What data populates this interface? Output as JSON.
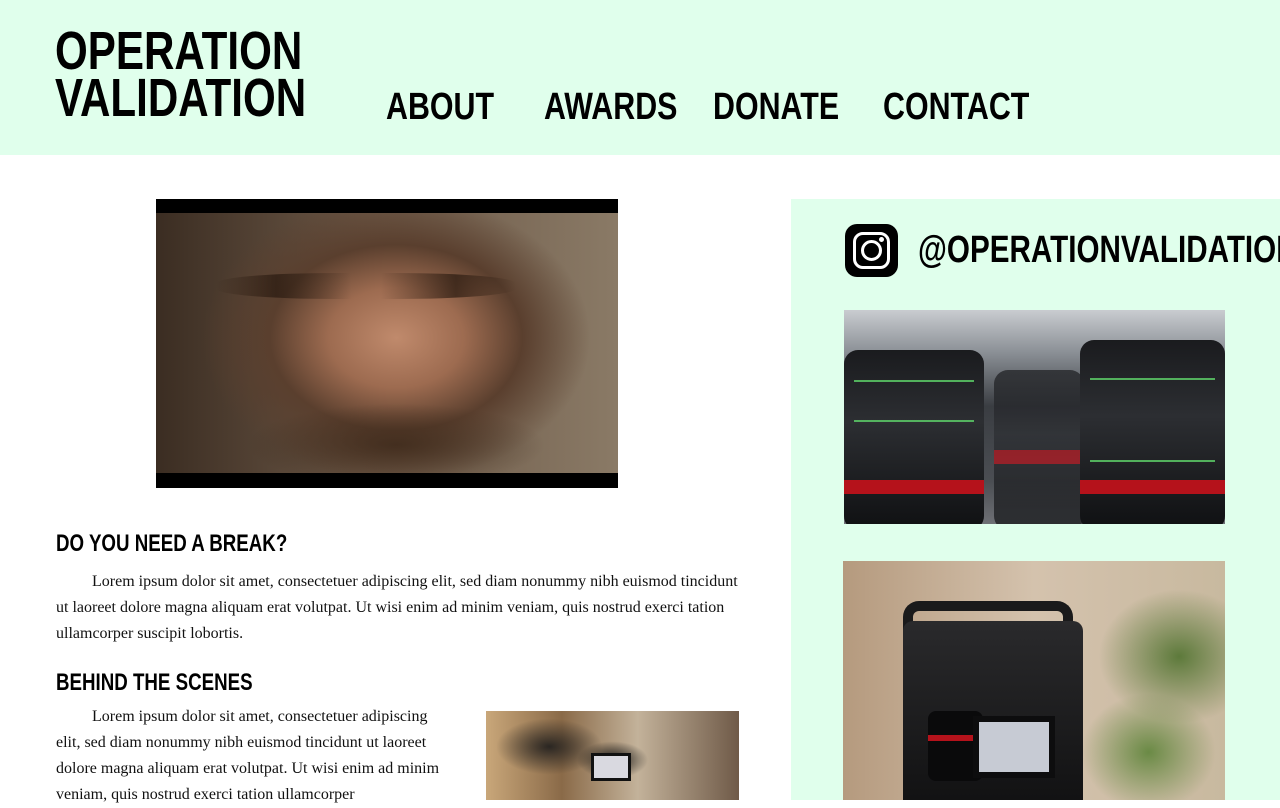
{
  "header": {
    "logo_line1": "OPERATION",
    "logo_line2": "VALIDATION",
    "nav": [
      "ABOUT",
      "AWARDS",
      "DONATE",
      "CONTACT"
    ]
  },
  "main": {
    "section1_heading": "DO YOU NEED A BREAK?",
    "section1_text": "Lorem ipsum dolor sit amet, consectetuer adipiscing elit, sed diam nonummy nibh euismod tincidunt ut laoreet dolore magna aliquam erat volutpat. Ut wisi enim ad minim veniam, quis nostrud exerci tation ullamcorper suscipit lobortis.",
    "section2_heading": "BEHIND THE SCENES",
    "section2_text": "Lorem ipsum dolor sit amet, consectetuer adipiscing elit, sed diam nonummy nibh euismod tincidunt ut laoreet dolore magna aliquam erat volutpat. Ut wisi enim ad minim veniam, quis nostrud exerci tation ullamcorper"
  },
  "sidebar": {
    "handle": "@OPERATIONVALIDATION",
    "icon": "instagram-icon"
  },
  "colors": {
    "accent_bg": "#e0ffec",
    "text": "#000000"
  }
}
